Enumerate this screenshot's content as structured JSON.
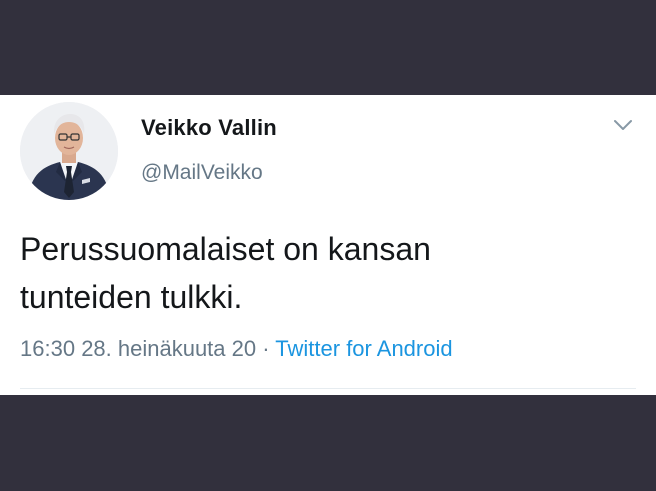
{
  "tweet": {
    "display_name": "Veikko Vallin",
    "handle": "@MailVeikko",
    "text_lines": [
      "Perussuomalaiset on kansan",
      "tunteiden tulkki."
    ],
    "time": "16:30",
    "date": "28. heinäkuuta 20",
    "separator": "·",
    "source": "Twitter for Android"
  },
  "icons": {
    "menu": "chevron-down-icon",
    "avatar": "profile-photo"
  },
  "colors": {
    "background_band": "#32303d",
    "card": "#ffffff",
    "text_primary": "#14171a",
    "text_secondary": "#657786",
    "link": "#1b95e0"
  }
}
